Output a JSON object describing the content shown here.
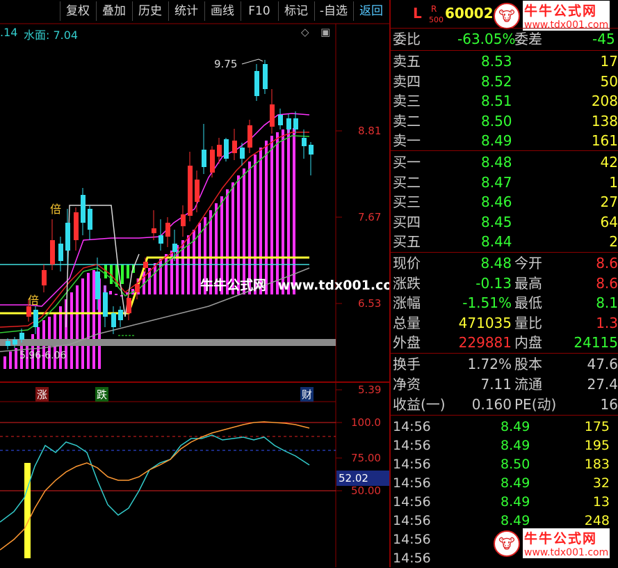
{
  "toolbar": {
    "items": [
      "复权",
      "叠加",
      "历史",
      "统计",
      "画线",
      "F10",
      "标记",
      "-自选",
      "返回"
    ]
  },
  "main_chart": {
    "indicator_prefix": ".14",
    "indicator_label": "水面: 7.04",
    "price_labels": [
      "8.81",
      "7.67",
      "6.53",
      "5.39"
    ],
    "peak_label": "9.75",
    "low_label": "5.96-6.06",
    "marker_bei_1": "倍",
    "marker_bei_2": "倍",
    "bottom_marks": {
      "zhang": "涨",
      "die": "跌",
      "cai": "财"
    }
  },
  "sub_chart": {
    "levels": [
      "100.0",
      "75.00",
      "50.00"
    ],
    "current_value": "52.02"
  },
  "watermark_center": {
    "name": "牛牛公式网",
    "url": "www.tdx001.com"
  },
  "watermark_corner": {
    "name": "牛牛公式网",
    "url": "www.tdx001.com"
  },
  "quote": {
    "header_l": "L",
    "header_r": "R",
    "header_500": "500",
    "code": "600026",
    "weibi_label": "委比",
    "weibi_value": "-63.05%",
    "weicha_label": "委差",
    "weicha_value": "-45",
    "sell": [
      {
        "label": "卖五",
        "price": "8.53",
        "vol": "17"
      },
      {
        "label": "卖四",
        "price": "8.52",
        "vol": "50"
      },
      {
        "label": "卖三",
        "price": "8.51",
        "vol": "208"
      },
      {
        "label": "卖二",
        "price": "8.50",
        "vol": "138"
      },
      {
        "label": "卖一",
        "price": "8.49",
        "vol": "161"
      }
    ],
    "buy": [
      {
        "label": "买一",
        "price": "8.48",
        "vol": "42"
      },
      {
        "label": "买二",
        "price": "8.47",
        "vol": "1"
      },
      {
        "label": "买三",
        "price": "8.46",
        "vol": "27"
      },
      {
        "label": "买四",
        "price": "8.45",
        "vol": "64"
      },
      {
        "label": "买五",
        "price": "8.44",
        "vol": "2"
      }
    ],
    "stats": [
      {
        "l1": "现价",
        "v1": "8.48",
        "l2": "今开",
        "v2": "8.6"
      },
      {
        "l1": "涨跌",
        "v1": "-0.13",
        "l2": "最高",
        "v2": "8.6"
      },
      {
        "l1": "涨幅",
        "v1": "-1.51%",
        "l2": "最低",
        "v2": "8.1"
      },
      {
        "l1": "总量",
        "v1": "471035",
        "l2": "量比",
        "v2": "1.3"
      },
      {
        "l1": "外盘",
        "v1": "229881",
        "l2": "内盘",
        "v2": "24115"
      }
    ],
    "fundamentals": [
      {
        "l1": "换手",
        "v1": "1.72%",
        "l2": "股本",
        "v2": "47.6"
      },
      {
        "l1": "净资",
        "v1": "7.11",
        "l2": "流通",
        "v2": "27.4"
      },
      {
        "l1": "收益(一)",
        "v1": "0.160",
        "l2": "PE(动)",
        "v2": "16"
      }
    ],
    "ticks": [
      {
        "time": "14:56",
        "price": "8.49",
        "vol": "175"
      },
      {
        "time": "14:56",
        "price": "8.49",
        "vol": "195"
      },
      {
        "time": "14:56",
        "price": "8.50",
        "vol": "183"
      },
      {
        "time": "14:56",
        "price": "8.49",
        "vol": "32"
      },
      {
        "time": "14:56",
        "price": "8.49",
        "vol": "13"
      },
      {
        "time": "14:56",
        "price": "8.49",
        "vol": "248"
      },
      {
        "time": "14:56",
        "price": "",
        "vol": ""
      },
      {
        "time": "14:56",
        "price": "",
        "vol": ""
      }
    ]
  },
  "colors": {
    "up": "#ff3030",
    "down": "#00e0e0",
    "magenta": "#ff33ff",
    "yellow": "#ffff33",
    "green": "#33ff33",
    "grid": "#8b0000"
  }
}
